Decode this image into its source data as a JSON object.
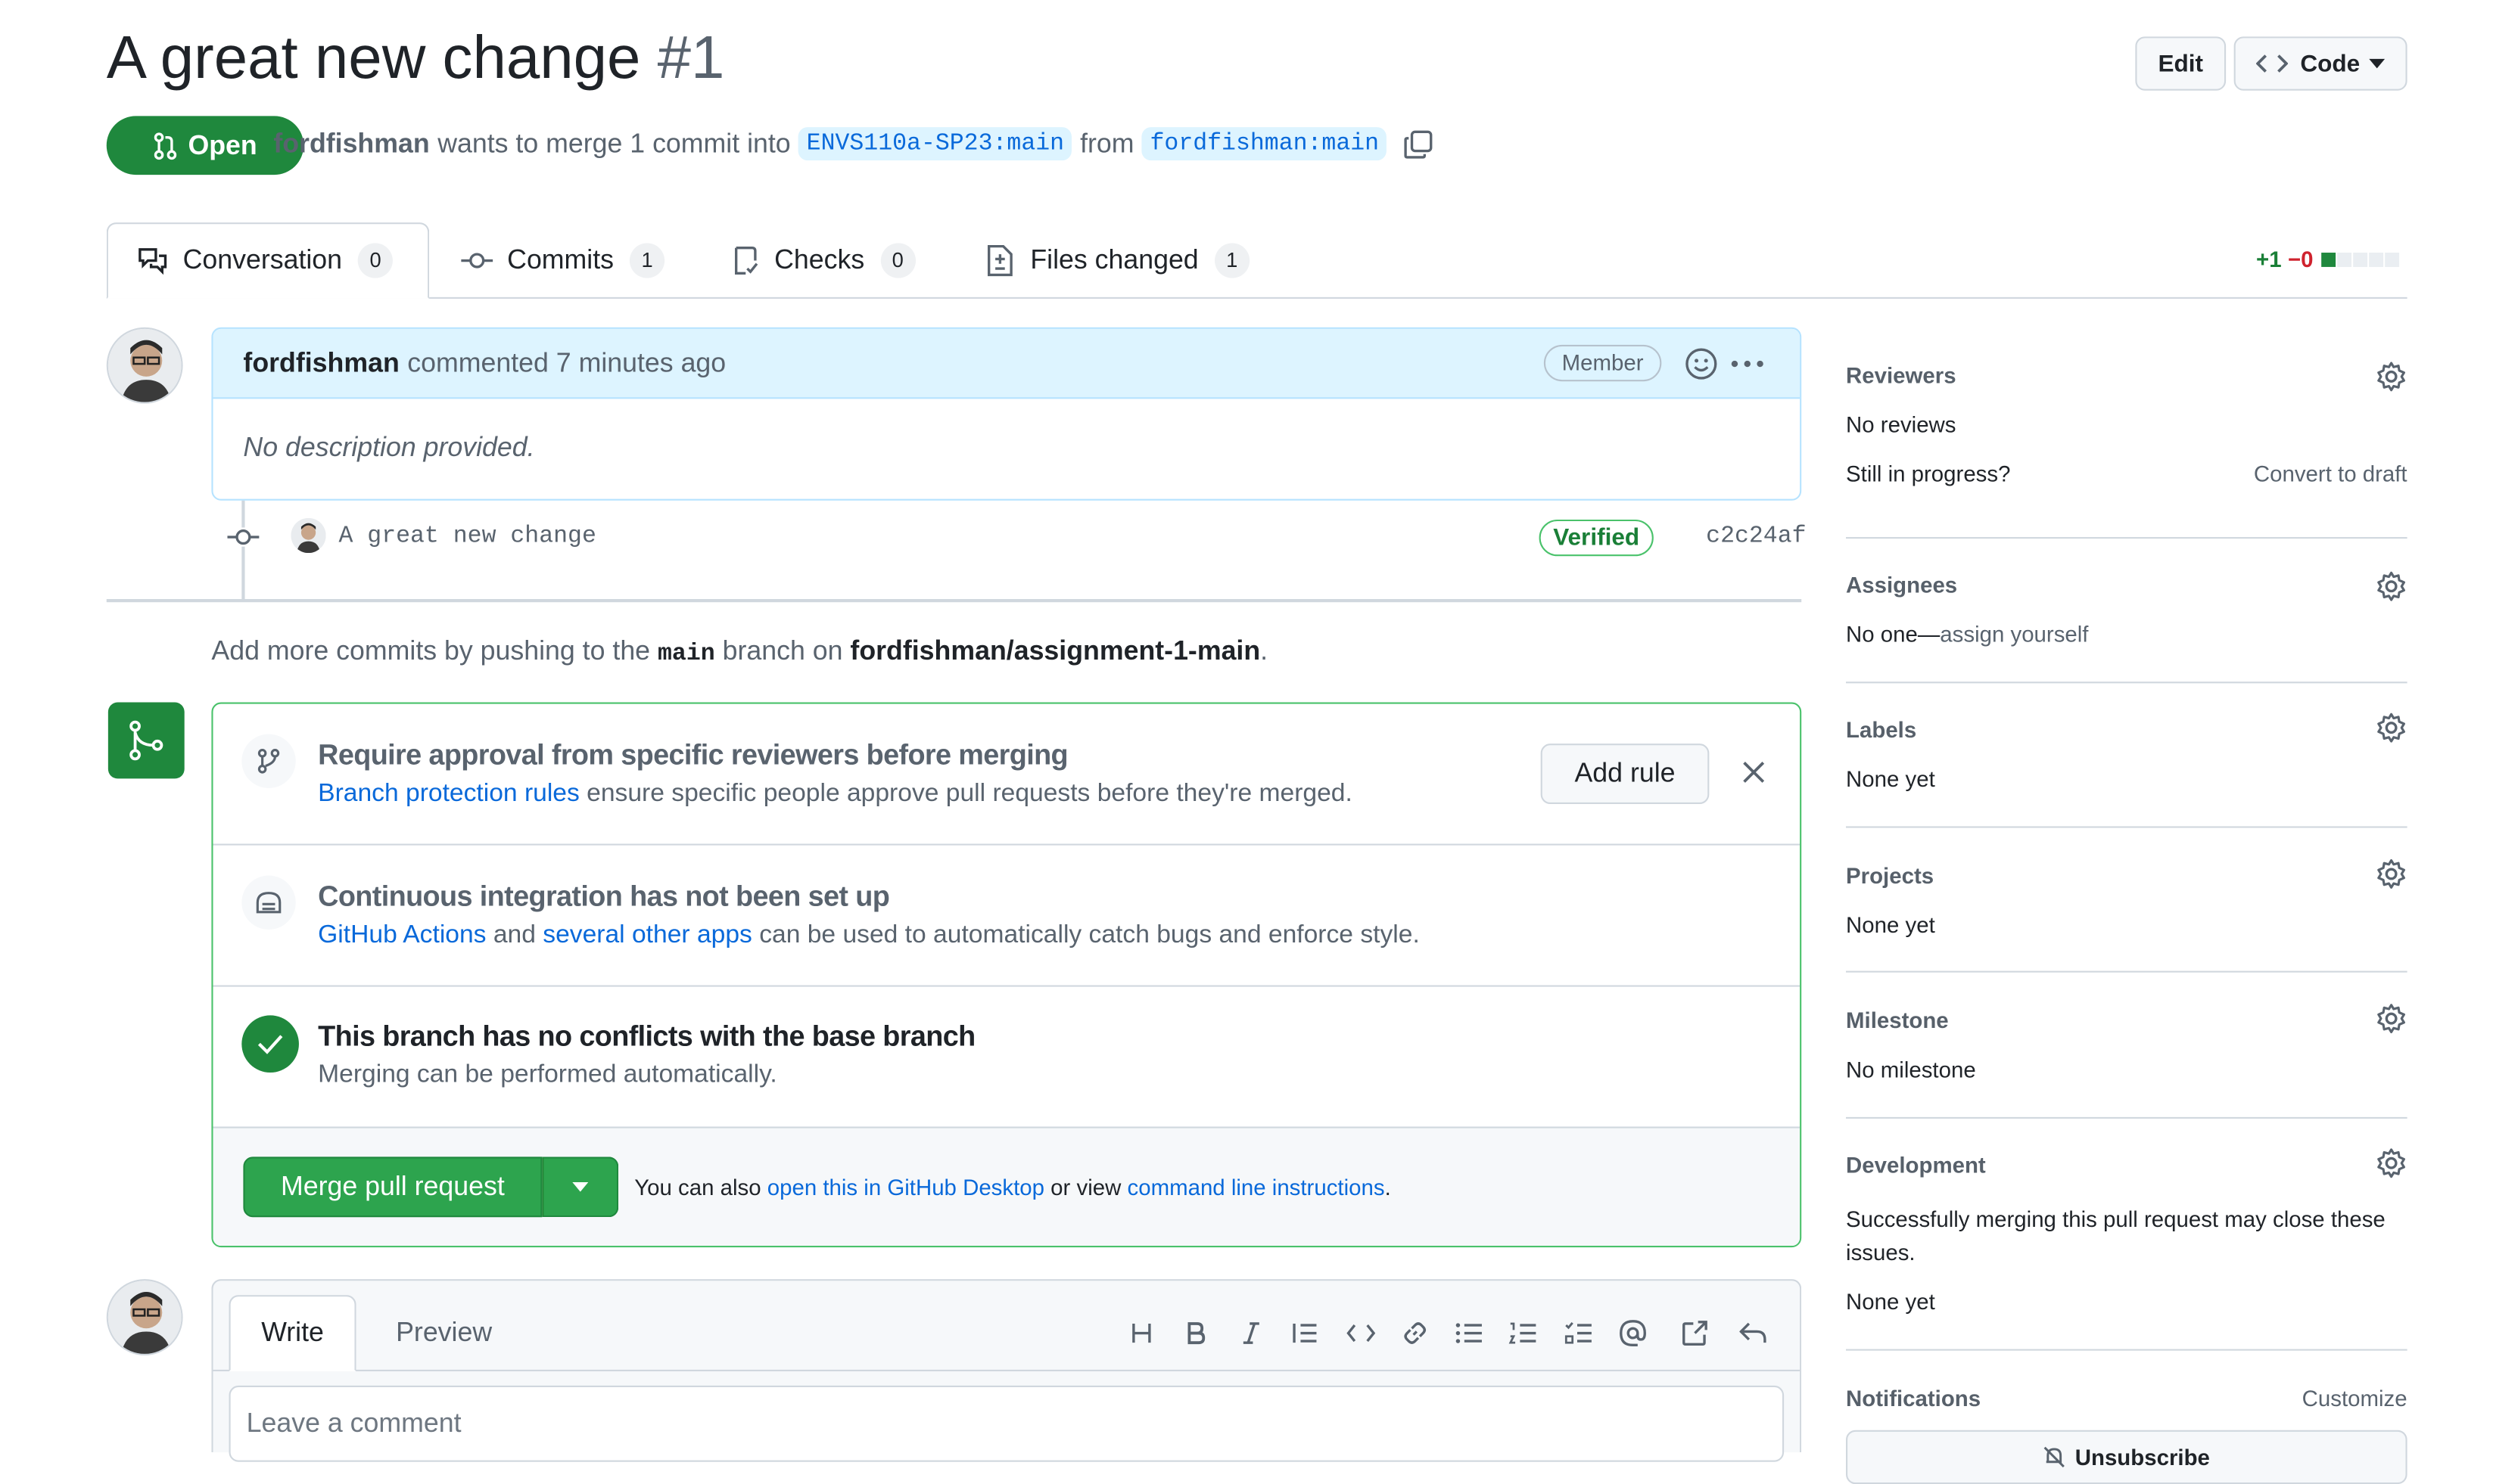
{
  "header": {
    "title": "A great new change",
    "number": "#1",
    "edit_label": "Edit",
    "code_label": "Code"
  },
  "status": {
    "state_label": "Open",
    "author": "fordfishman",
    "merge_text": "wants to merge 1 commit into",
    "base_branch": "ENVS110a-SP23:main",
    "from_text": "from",
    "head_branch": "fordfishman:main"
  },
  "tabs": [
    {
      "label": "Conversation",
      "count": "0"
    },
    {
      "label": "Commits",
      "count": "1"
    },
    {
      "label": "Checks",
      "count": "0"
    },
    {
      "label": "Files changed",
      "count": "1"
    }
  ],
  "diffstat": {
    "added": "+1",
    "removed": "−0"
  },
  "comment": {
    "author": "fordfishman",
    "meta": "commented 7 minutes ago",
    "role_badge": "Member",
    "body": "No description provided."
  },
  "commit": {
    "message": "A great new change",
    "verified_label": "Verified",
    "sha": "c2c24af"
  },
  "push_hint": {
    "prefix": "Add more commits by pushing to the",
    "branch": "main",
    "middle": "branch on",
    "repo": "fordfishman/assignment-1-main",
    "suffix": "."
  },
  "merge_box": {
    "rule_title": "Require approval from specific reviewers before merging",
    "rule_link": "Branch protection rules",
    "rule_text": "ensure specific people approve pull requests before they're merged.",
    "add_rule_label": "Add rule",
    "ci_title": "Continuous integration has not been set up",
    "ci_link1": "GitHub Actions",
    "ci_and": "and",
    "ci_link2": "several other apps",
    "ci_text": "can be used to automatically catch bugs and enforce style.",
    "conflict_title": "This branch has no conflicts with the base branch",
    "conflict_text": "Merging can be performed automatically.",
    "merge_button": "Merge pull request",
    "also_text": "You can also",
    "desktop_link": "open this in GitHub Desktop",
    "or_view": "or view",
    "cli_link": "command line instructions",
    "period": "."
  },
  "composer": {
    "write_tab": "Write",
    "preview_tab": "Preview",
    "placeholder": "Leave a comment",
    "toolbar_icons": [
      "heading-icon",
      "bold-icon",
      "italic-icon",
      "quote-icon",
      "code-icon",
      "link-icon",
      "unordered-list-icon",
      "ordered-list-icon",
      "task-list-icon",
      "mention-icon",
      "cross-reference-icon",
      "reply-icon"
    ]
  },
  "sidebar": {
    "reviewers_title": "Reviewers",
    "reviewers_value": "No reviews",
    "in_progress": "Still in progress?",
    "convert_draft": "Convert to draft",
    "assignees_title": "Assignees",
    "assignees_prefix": "No one—",
    "assign_yourself": "assign yourself",
    "labels_title": "Labels",
    "labels_value": "None yet",
    "projects_title": "Projects",
    "projects_value": "None yet",
    "milestone_title": "Milestone",
    "milestone_value": "No milestone",
    "development_title": "Development",
    "development_text": "Successfully merging this pull request may close these issues.",
    "development_value": "None yet",
    "notifications_title": "Notifications",
    "customize": "Customize",
    "unsubscribe": "Unsubscribe"
  },
  "colors": {
    "open_green": "#1f883d",
    "merge_green": "#2da44e",
    "link_blue": "#0969da",
    "comment_header_bg": "#ddf4ff",
    "border": "#d0d7de",
    "diff_red": "#cf222e"
  }
}
